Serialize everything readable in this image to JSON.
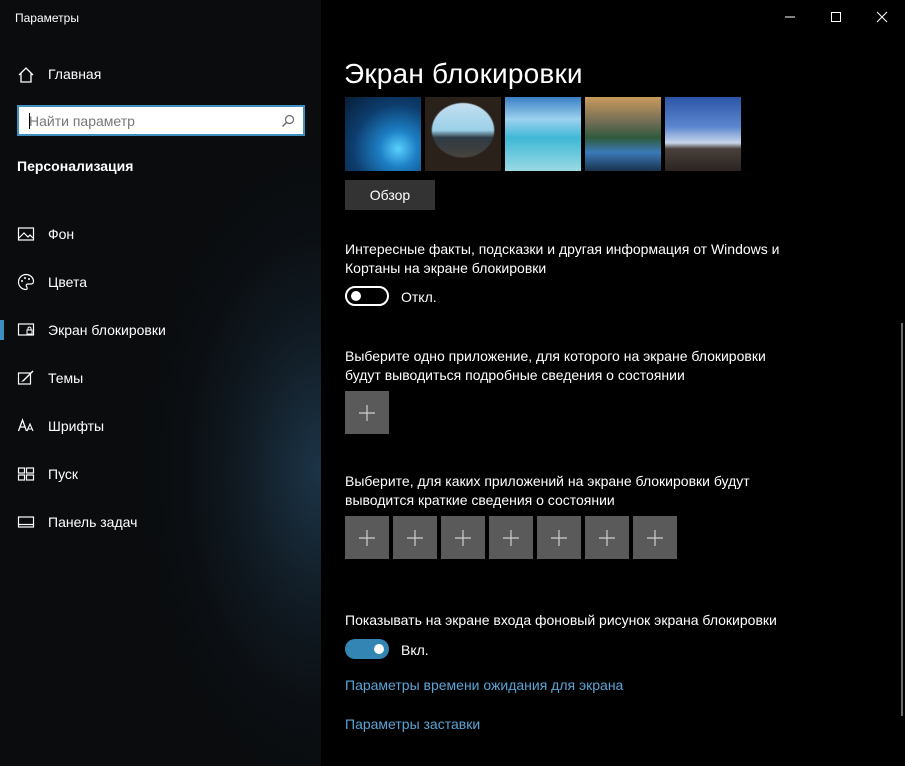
{
  "window": {
    "title": "Параметры"
  },
  "sidebar": {
    "home_label": "Главная",
    "search": {
      "placeholder": "Найти параметр",
      "value": ""
    },
    "section_title": "Персонализация",
    "items": [
      {
        "label": "Фон",
        "icon": "picture-icon",
        "active": false
      },
      {
        "label": "Цвета",
        "icon": "palette-icon",
        "active": false
      },
      {
        "label": "Экран блокировки",
        "icon": "lock-screen-icon",
        "active": true
      },
      {
        "label": "Темы",
        "icon": "themes-icon",
        "active": false
      },
      {
        "label": "Шрифты",
        "icon": "fonts-icon",
        "active": false
      },
      {
        "label": "Пуск",
        "icon": "start-icon",
        "active": false
      },
      {
        "label": "Панель задач",
        "icon": "taskbar-icon",
        "active": false
      }
    ]
  },
  "main": {
    "title": "Экран блокировки",
    "browse_label": "Обзор",
    "fun_facts": {
      "text": "Интересные факты, подсказки и другая информация от Windows и Кортаны на экране блокировки",
      "toggle_label": "Откл.",
      "state": "off"
    },
    "detailed_status": {
      "text": "Выберите одно приложение, для которого на экране блокировки будут выводиться подробные сведения о состоянии"
    },
    "quick_status": {
      "text": "Выберите, для каких приложений на экране блокировки будут выводится краткие сведения о состоянии",
      "slots": 7
    },
    "signin_background": {
      "text": "Показывать на экране входа фоновый рисунок экрана блокировки",
      "toggle_label": "Вкл.",
      "state": "on"
    },
    "links": {
      "timeout": "Параметры времени ожидания для экрана",
      "screensaver": "Параметры заставки"
    }
  },
  "colors": {
    "accent": "#3386b3",
    "link": "#5aa4d6",
    "sidebar_bg": "#0b0f13"
  }
}
